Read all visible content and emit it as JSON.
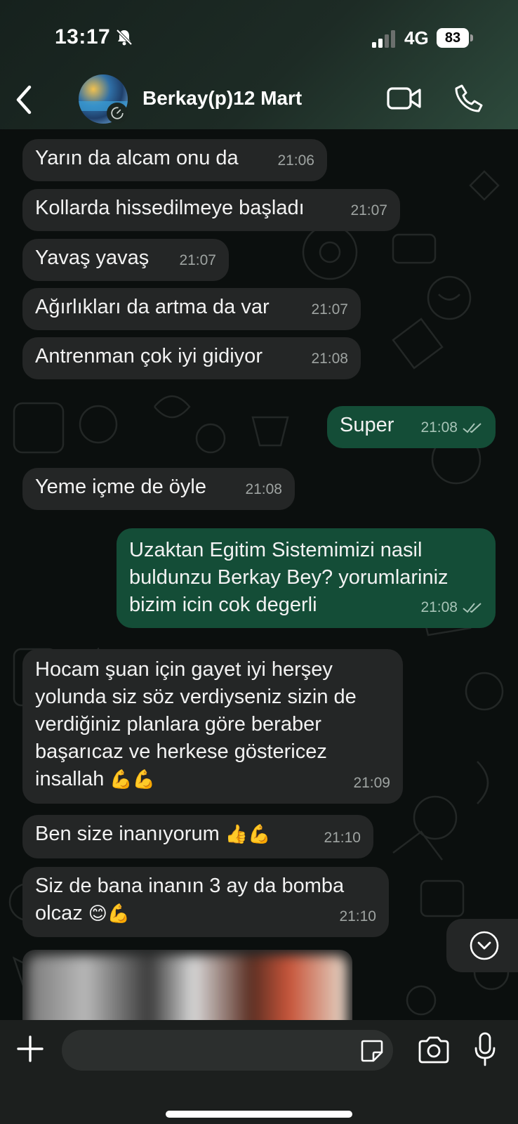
{
  "status": {
    "time": "13:17",
    "network": "4G",
    "battery": "83"
  },
  "header": {
    "contact_name": "Berkay(p)12 Mart"
  },
  "messages": [
    {
      "direction": "in",
      "text": "Yarın da alcam onu da",
      "time": "21:06"
    },
    {
      "direction": "in",
      "text": "Kollarda hissedilmeye başladı",
      "time": "21:07"
    },
    {
      "direction": "in",
      "text": "Yavaş yavaş",
      "time": "21:07"
    },
    {
      "direction": "in",
      "text": "Ağırlıkları da artma da var",
      "time": "21:07"
    },
    {
      "direction": "in",
      "text": "Antrenman çok iyi gidiyor",
      "time": "21:08"
    },
    {
      "direction": "out",
      "text": "Super",
      "time": "21:08"
    },
    {
      "direction": "in",
      "text": "Yeme içme de öyle",
      "time": "21:08"
    },
    {
      "direction": "out",
      "lines": [
        "Uzaktan Egitim Sistemimizi nasil",
        "buldunzu Berkay Bey? yorumlariniz",
        "bizim icin cok degerli"
      ],
      "time": "21:08"
    },
    {
      "direction": "in",
      "lines": [
        "Hocam şuan için gayet iyi herşey",
        "yolunda siz söz verdiyseniz sizin de",
        "verdiğiniz planlara göre beraber",
        "başarıcaz ve herkese göstericez",
        "insallah"
      ],
      "emoji": "💪💪",
      "time": "21:09"
    },
    {
      "direction": "in",
      "text": "Ben size inanıyorum",
      "emoji": "👍💪",
      "time": "21:10"
    },
    {
      "direction": "in",
      "lines": [
        "Siz de bana inanın 3 ay da bomba",
        "olcaz"
      ],
      "emoji": "😊💪",
      "time": "21:10"
    }
  ],
  "icons": {
    "back": "chevron-left-icon",
    "video": "video-camera-icon",
    "call": "phone-icon",
    "scroll": "chevron-down-circle-icon",
    "plus": "plus-icon",
    "sticker": "sticker-icon",
    "camera": "camera-icon",
    "mic": "microphone-icon"
  },
  "colors": {
    "incoming_bubble": "#242626",
    "outgoing_bubble": "#144d37",
    "background": "#0b0f0e"
  }
}
